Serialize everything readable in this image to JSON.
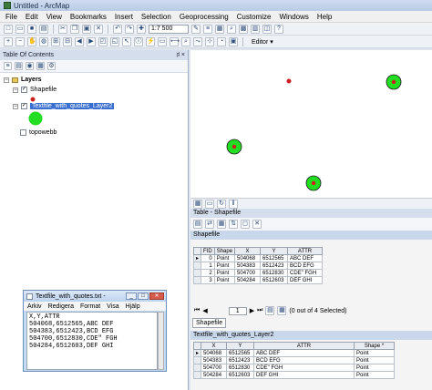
{
  "window": {
    "title": "Untitled - ArcMap"
  },
  "menu": [
    "File",
    "Edit",
    "View",
    "Bookmarks",
    "Insert",
    "Selection",
    "Geoprocessing",
    "Customize",
    "Windows",
    "Help"
  ],
  "toolbar": {
    "scale": "1:7 500",
    "editor_label": "Editor ▾"
  },
  "toc": {
    "title": "Table Of Contents",
    "pin": "♯ ×",
    "root": "Layers",
    "layers": [
      {
        "name": "Shapefile",
        "checked": true,
        "selected": false
      },
      {
        "name": "Textfile_with_quotes_Layer2",
        "checked": true,
        "selected": true
      },
      {
        "name": "topowebb",
        "checked": false,
        "selected": false
      }
    ]
  },
  "colors": {
    "accent": "#3a6fcf",
    "point_small": "#cc1f1f",
    "point_large_fill": "#22dd22"
  },
  "table": {
    "window_title": "Table - Shapefile",
    "shapefile_tab": "Shapefile",
    "shapefile_headers": [
      "FID",
      "Shape",
      "X",
      "Y",
      "ATTR"
    ],
    "shapefile_rows": [
      [
        "0",
        "Point",
        "504068",
        "6512565",
        "ABC DEF"
      ],
      [
        "1",
        "Point",
        "504383",
        "6512423",
        "BCD EFG"
      ],
      [
        "2",
        "Point",
        "504700",
        "6512830",
        "CDE\" FGH"
      ],
      [
        "3",
        "Point",
        "504284",
        "6512603",
        "DEF GHI"
      ]
    ],
    "nav_current": "1",
    "selection_text": "(0 out of 4 Selected)",
    "tab_label": "Shapefile",
    "layer2_title": "Textfile_with_quotes_Layer2",
    "layer2_headers": [
      "X",
      "Y",
      "ATTR",
      "Shape *"
    ],
    "layer2_rows": [
      [
        "504068",
        "6512565",
        "ABC DEF",
        "Point"
      ],
      [
        "504383",
        "6512423",
        "BCD EFG",
        "Point"
      ],
      [
        "504700",
        "6512830",
        "CDE\" FGH",
        "Point"
      ],
      [
        "504284",
        "6512603",
        "DEF GHI",
        "Point"
      ]
    ]
  },
  "notepad": {
    "title": "Textfile_with_quotes.txt -",
    "menu": [
      "Arkiv",
      "Redigera",
      "Format",
      "Visa",
      "Hjälp"
    ],
    "lines": [
      "X,Y,ATTR",
      "504068,6512565,ABC DEF",
      "504383,6512423,BCD EFG",
      "504700,6512830,CDE\" FGH",
      "504284,6512603,DEF GHI"
    ]
  }
}
